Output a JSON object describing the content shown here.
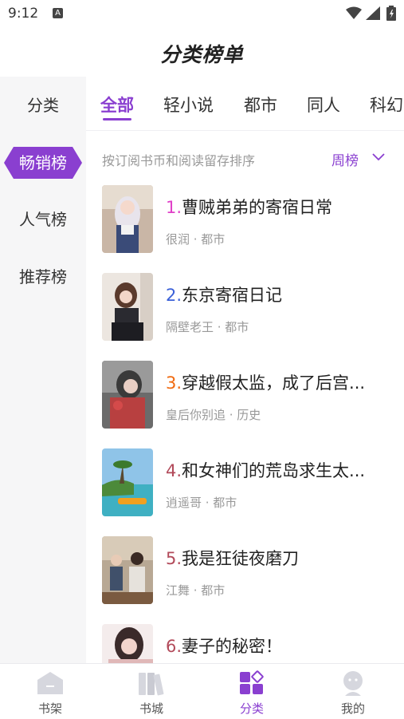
{
  "status_bar": {
    "time": "9:12",
    "notification_icon": "A"
  },
  "header": {
    "title": "分类榜单"
  },
  "sidebar": {
    "items": [
      {
        "label": "分类"
      },
      {
        "label": "畅销榜",
        "active": true
      },
      {
        "label": "人气榜"
      },
      {
        "label": "推荐榜"
      }
    ]
  },
  "tabs": [
    {
      "label": "全部",
      "active": true
    },
    {
      "label": "轻小说"
    },
    {
      "label": "都市"
    },
    {
      "label": "同人"
    },
    {
      "label": "科幻"
    }
  ],
  "sort_bar": {
    "hint": "按订阅书币和阅读留存排序",
    "period": "周榜"
  },
  "books": [
    {
      "rank": "1.",
      "title": "曹贼弟弟的寄宿日常",
      "meta": "很润 · 都市",
      "rank_color": "#e040c8"
    },
    {
      "rank": "2.",
      "title": "东京寄宿日记",
      "meta": "隔壁老王 · 都市",
      "rank_color": "#3a60d8"
    },
    {
      "rank": "3.",
      "title": "穿越假太监，成了后宫...",
      "meta": "皇后你别追 · 历史",
      "rank_color": "#f06a10"
    },
    {
      "rank": "4.",
      "title": "和女神们的荒岛求生太...",
      "meta": "逍遥哥 · 都市",
      "rank_color": "#b24a5a"
    },
    {
      "rank": "5.",
      "title": "我是狂徒夜磨刀",
      "meta": "江舞 · 都市",
      "rank_color": "#b24a5a"
    },
    {
      "rank": "6.",
      "title": "妻子的秘密！",
      "meta": "",
      "rank_color": "#b24a5a"
    }
  ],
  "bottom_nav": {
    "items": [
      {
        "label": "书架",
        "icon": "bookshelf-icon"
      },
      {
        "label": "书城",
        "icon": "bookstore-icon"
      },
      {
        "label": "分类",
        "icon": "category-icon",
        "active": true
      },
      {
        "label": "我的",
        "icon": "profile-icon"
      }
    ]
  },
  "colors": {
    "accent": "#8a3fd0",
    "sidebar_bg": "#f6f6f7",
    "muted_text": "#999999"
  }
}
